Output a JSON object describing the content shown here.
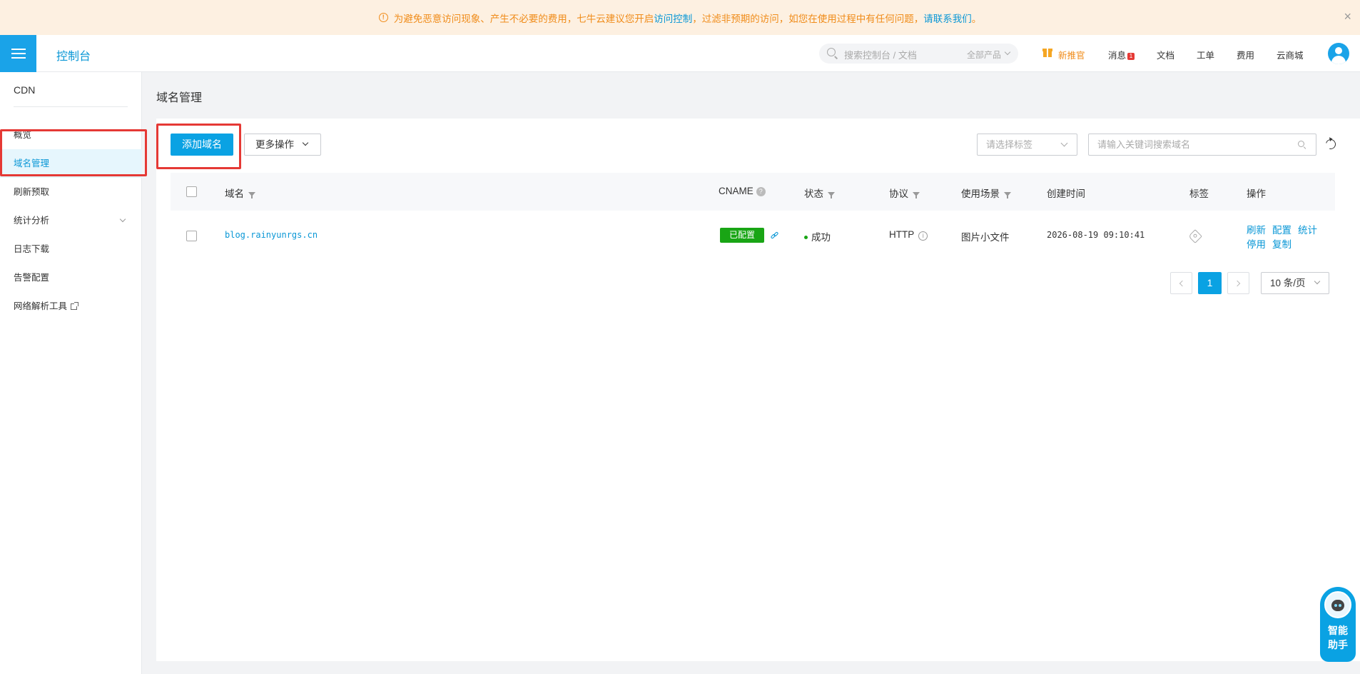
{
  "notice": {
    "text_before": "为避免恶意访问现象、产生不必要的费用，七牛云建议您开启",
    "link1": "访问控制",
    "text_middle": "，过滤非预期的访问，如您在使用过程中有任何问题，",
    "link2": "请联系我们",
    "text_after": "。",
    "close": "×"
  },
  "topbar": {
    "brand": "控制台",
    "search_placeholder": "搜索控制台 / 文档",
    "search_scope": "全部产品",
    "nav": {
      "new": "新推官",
      "messages": "消息",
      "messages_badge": "1",
      "docs": "文档",
      "tickets": "工单",
      "billing": "费用",
      "market": "云商城"
    }
  },
  "sidebar": {
    "title": "CDN",
    "items": [
      {
        "label": "概览"
      },
      {
        "label": "域名管理"
      },
      {
        "label": "刷新预取"
      },
      {
        "label": "统计分析"
      },
      {
        "label": "日志下载"
      },
      {
        "label": "告警配置"
      },
      {
        "label": "网络解析工具"
      }
    ]
  },
  "main": {
    "page_title": "域名管理",
    "add_button": "添加域名",
    "more_button": "更多操作",
    "tag_placeholder": "请选择标签",
    "keyword_placeholder": "请输入关键词搜索域名",
    "table": {
      "columns": {
        "domain": "域名",
        "cname": "CNAME",
        "status": "状态",
        "protocol": "协议",
        "scene": "使用场景",
        "created": "创建时间",
        "tags": "标签",
        "actions": "操作"
      },
      "rows": [
        {
          "domain": "blog.rainyunrgs.cn",
          "cname": "已配置",
          "status": "成功",
          "protocol": "HTTP",
          "scene": "图片小文件",
          "created": "2026-08-19 09:10:41",
          "actions": [
            "刷新",
            "配置",
            "统计",
            "停用",
            "复制"
          ]
        }
      ]
    },
    "pagination": {
      "current": "1",
      "page_size": "10 条/页"
    }
  },
  "assistant": {
    "line1": "智能",
    "line2": "助手"
  },
  "colors": {
    "accent": "#0aa2e3",
    "success": "#19a515",
    "warning": "#f08c1a",
    "highlight": "#e53935"
  }
}
